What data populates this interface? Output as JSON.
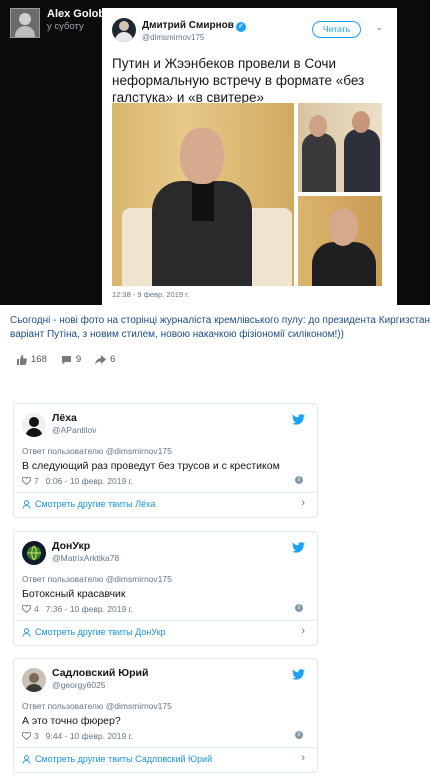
{
  "post": {
    "author_name": "Alex Golobuckij",
    "time": "у суботу",
    "caption_line1": "Сьогодні - нові фото на сторінці журналіста кремлівського пулу: до президента Киргизстану відправили",
    "caption_line2": "варіант Путіна, з новим стилем, новою накачкою фізіономії силіконом!))",
    "stats": {
      "likes": "168",
      "comments": "9",
      "shares": "6"
    }
  },
  "embedded": {
    "name": "Дмитрий Смирнов",
    "handle": "@dimsmirnov175",
    "follow_label": "Читать",
    "text": "Путин и Жээнбеков провели в Сочи неформальную встречу в формате «без галстука» и «в свитере»",
    "timestamp": "12:38 - 9 февр. 2019 г."
  },
  "replies": [
    {
      "name": "Лёха",
      "handle": "@APantilov",
      "reply_to": "Ответ пользователю @dimsmirnov175",
      "text": "В следующий раз проведут без трусов и с крестиком",
      "likes": "7",
      "time": "0:06 - 10 февр. 2019 г.",
      "more": "Смотреть другие твиты Лёха"
    },
    {
      "name": "ДонУкр",
      "handle": "@MatrixArktika78",
      "reply_to": "Ответ пользователю @dimsmirnov175",
      "text": "Ботоксный красавчик",
      "likes": "4",
      "time": "7:36 - 10 февр. 2019 г.",
      "more": "Смотреть другие твиты ДонУкр"
    },
    {
      "name": "Садловский Юрий",
      "handle": "@georgy6025",
      "reply_to": "Ответ пользователю @dimsmirnov175",
      "text": "А это точно фюрер?",
      "likes": "3",
      "time": "9:44 - 10 февр. 2019 г.",
      "more": "Смотреть другие твиты Садловский Юрий"
    }
  ],
  "colors": {
    "twitter_blue": "#1da1f2",
    "link_blue": "#1b95e0",
    "caption_blue": "#1c4f8a"
  },
  "icons": [
    "like-icon",
    "comment-icon",
    "share-icon",
    "verified-icon",
    "twitter-bird-icon",
    "heart-icon",
    "info-icon",
    "profile-icon",
    "chevron-right-icon"
  ]
}
